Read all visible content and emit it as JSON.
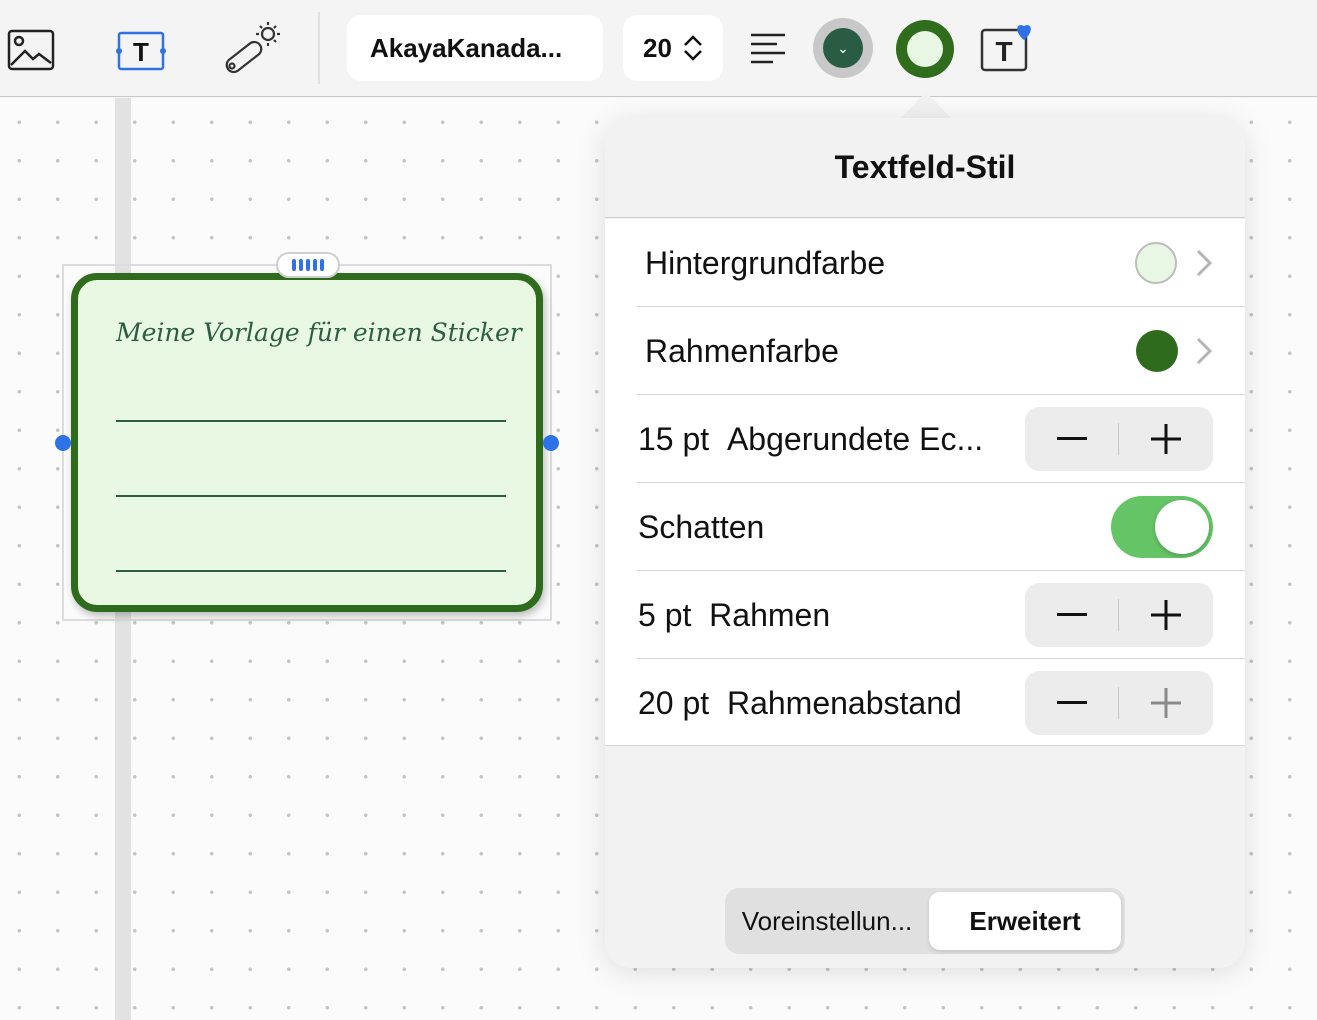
{
  "toolbar": {
    "icons": [
      "image-icon",
      "text-box-icon",
      "laser-pointer-icon",
      "align-left-icon",
      "text-style-icon"
    ],
    "font_name": "AkayaKanada...",
    "font_size": "20",
    "text_color": "#2a5c44",
    "box_border_color": "#2f6d1d",
    "box_fill_color": "#e7f7e3",
    "badge_color": "#2f72e8"
  },
  "sticker": {
    "title": "Meine Vorlage für einen Sticker",
    "background_color": "#e8f8e2",
    "border_color": "#2e6b1c"
  },
  "popover": {
    "title": "Textfeld-Stil",
    "rows": [
      {
        "label": "Hintergrundfarbe",
        "swatch_color": "#e7f7e3"
      },
      {
        "label": "Rahmenfarbe",
        "swatch_color": "#2e6b1c"
      },
      {
        "value": "15 pt",
        "label": "Abgerundete Ec..."
      },
      {
        "label": "Schatten",
        "toggle_on": true
      },
      {
        "value": "5 pt",
        "label": "Rahmen"
      },
      {
        "value": "20 pt",
        "label": "Rahmenabstand"
      }
    ],
    "segments": [
      "Voreinstellun...",
      "Erweitert"
    ],
    "selected_segment": "Erweitert",
    "toggle_color": "#65c466"
  }
}
